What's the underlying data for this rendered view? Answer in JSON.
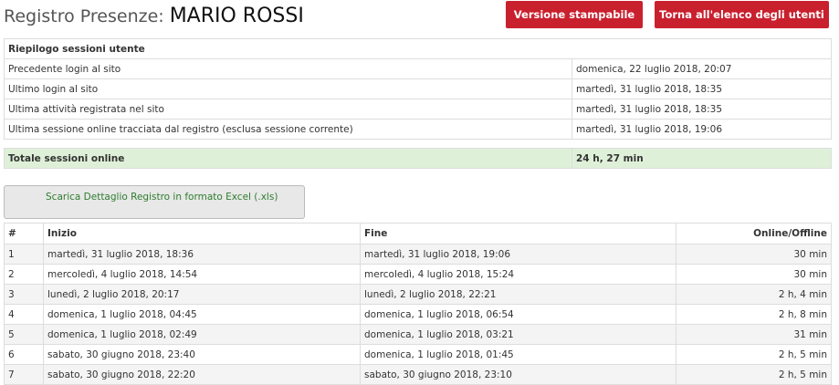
{
  "page": {
    "title_prefix": "Registro Presenze:",
    "user_name": "MARIO ROSSI",
    "print_button": "Versione stampabile",
    "back_button": "Torna all'elenco degli utenti"
  },
  "summary": {
    "header": "Riepilogo sessioni utente",
    "rows": [
      {
        "label": "Precedente login al sito",
        "value": "domenica, 22 luglio 2018, 20:07"
      },
      {
        "label": "Ultimo login al sito",
        "value": "martedì, 31 luglio 2018, 18:35"
      },
      {
        "label": "Ultima attività registrata nel sito",
        "value": "martedì, 31 luglio 2018, 18:35"
      },
      {
        "label": "Ultima sessione online tracciata dal registro (esclusa sessione corrente)",
        "value": "martedì, 31 luglio 2018, 19:06"
      }
    ],
    "total_label": "Totale sessioni online",
    "total_value": "24 h, 27 min"
  },
  "download": {
    "label": "Scarica Dettaglio Registro in formato Excel (.xls)"
  },
  "detail": {
    "columns": {
      "num": "#",
      "start": "Inizio",
      "end": "Fine",
      "online": "Online/Offline"
    },
    "rows": [
      {
        "num": "1",
        "start": "martedì, 31 luglio 2018, 18:36",
        "end": "martedì, 31 luglio 2018, 19:06",
        "online": "30 min"
      },
      {
        "num": "2",
        "start": "mercoledì, 4 luglio 2018, 14:54",
        "end": "mercoledì, 4 luglio 2018, 15:24",
        "online": "30 min"
      },
      {
        "num": "3",
        "start": "lunedì, 2 luglio 2018, 20:17",
        "end": "lunedì, 2 luglio 2018, 22:21",
        "online": "2 h, 4 min"
      },
      {
        "num": "4",
        "start": "domenica, 1 luglio 2018, 04:45",
        "end": "domenica, 1 luglio 2018, 06:54",
        "online": "2 h, 8 min"
      },
      {
        "num": "5",
        "start": "domenica, 1 luglio 2018, 02:49",
        "end": "domenica, 1 luglio 2018, 03:21",
        "online": "31 min"
      },
      {
        "num": "6",
        "start": "sabato, 30 giugno 2018, 23:40",
        "end": "domenica, 1 luglio 2018, 01:45",
        "online": "2 h, 5 min"
      },
      {
        "num": "7",
        "start": "sabato, 30 giugno 2018, 22:20",
        "end": "sabato, 30 giugno 2018, 23:10",
        "online": "2 h, 5 min"
      }
    ]
  },
  "colors": {
    "accent_red": "#c9202e",
    "total_green": "#dff0d8",
    "link_green": "#2e7d2e"
  }
}
